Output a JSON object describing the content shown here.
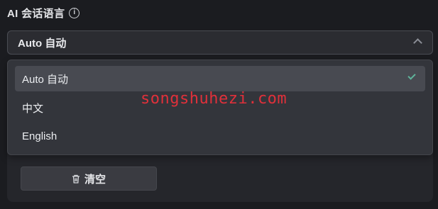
{
  "field": {
    "label": "AI 会话语言",
    "info_icon": "i"
  },
  "select": {
    "value": "Auto 自动",
    "expanded": true,
    "chevron_icon": "chevron-up-icon"
  },
  "dropdown": {
    "options": [
      {
        "label": "Auto 自动",
        "selected": true
      },
      {
        "label": "中文",
        "selected": false
      },
      {
        "label": "English",
        "selected": false
      }
    ],
    "check_color": "#5fb39a"
  },
  "actions": {
    "clear_label": "清空",
    "clear_icon": "trash-icon"
  },
  "watermark": {
    "text": "songshuhezi.com",
    "color": "#e0303a"
  }
}
